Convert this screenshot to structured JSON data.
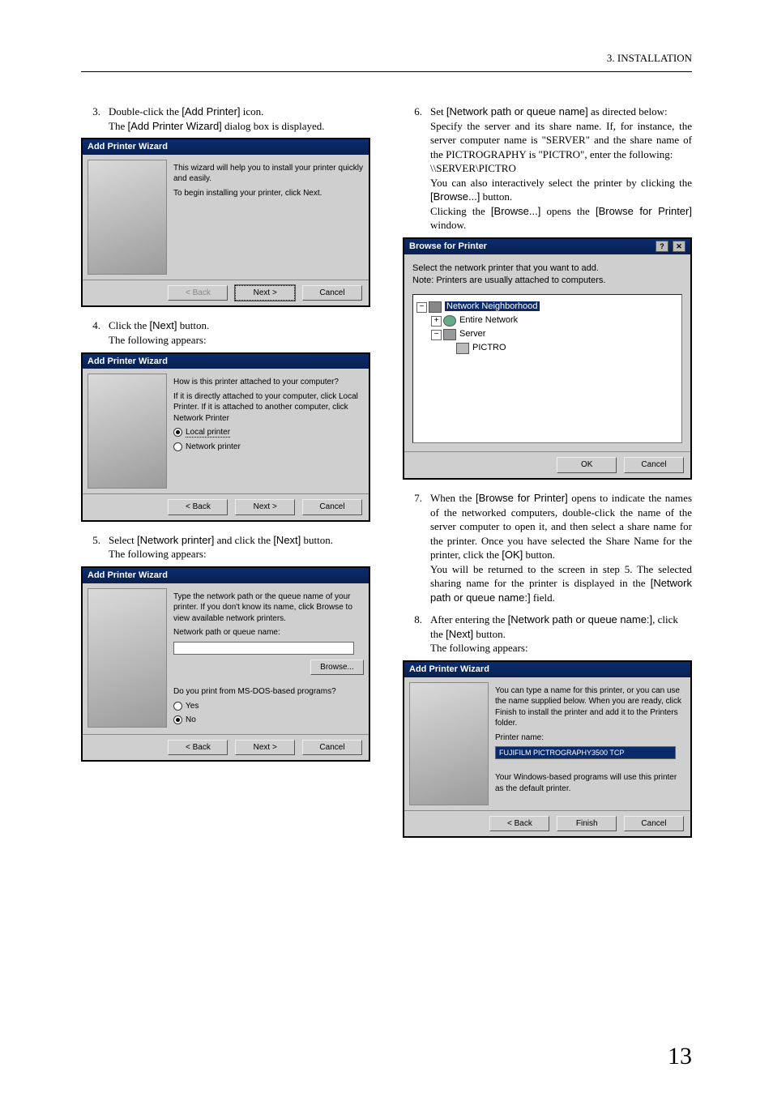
{
  "header": {
    "section_label": "3. INSTALLATION"
  },
  "page_number": "13",
  "left": {
    "step3": {
      "num": "3.",
      "line1_a": "Double-click the ",
      "line1_ui": "[Add Printer]",
      "line1_b": " icon.",
      "line2_a": "The ",
      "line2_ui": "[Add Printer Wizard]",
      "line2_b": " dialog box is displayed."
    },
    "dlg1": {
      "title": "Add Printer Wizard",
      "text1": "This wizard will help you to install your printer quickly and easily.",
      "text2": "To begin installing your printer, click Next.",
      "back": "< Back",
      "next": "Next >",
      "cancel": "Cancel"
    },
    "step4": {
      "num": "4.",
      "line1_a": "Click the ",
      "line1_ui": "[Next]",
      "line1_b": " button.",
      "line2": "The following appears:"
    },
    "dlg2": {
      "title": "Add Printer Wizard",
      "q": "How is this printer attached to your computer?",
      "text": "If it is directly attached to your computer, click Local Printer. If it is attached to another computer, click Network Printer",
      "opt1": "Local printer",
      "opt2": "Network printer",
      "back": "< Back",
      "next": "Next >",
      "cancel": "Cancel"
    },
    "step5": {
      "num": "5.",
      "line1_a": "Select ",
      "line1_ui": "[Network printer]",
      "line1_b": " and click the ",
      "line1_ui2": "[Next]",
      "line1_c": " button.",
      "line2": "The following appears:"
    },
    "dlg3": {
      "title": "Add Printer Wizard",
      "text": "Type the network path or the queue name of your printer. If you don't know its name, click Browse to view available network printers.",
      "label": "Network path or queue name:",
      "browse": "Browse...",
      "q2": "Do you print from MS-DOS-based programs?",
      "yes": "Yes",
      "no": "No",
      "back": "< Back",
      "next": "Next >",
      "cancel": "Cancel"
    }
  },
  "right": {
    "step6": {
      "num": "6.",
      "line1_a": "Set ",
      "line1_ui": "[Network path or queue name]",
      "line1_b": " as directed below:",
      "line2": "Specify the server and its share name.  If, for instance, the server computer name is \"SERVER\" and the share name of the PICTROGRAPHY is \"PICTRO\", enter the following:",
      "path": "\\\\SERVER\\PICTRO",
      "line3_a": "You can also interactively select the printer by clicking the ",
      "line3_ui": "[Browse...]",
      "line3_b": " button.",
      "line4_a": "Clicking the ",
      "line4_ui": "[Browse...]",
      "line4_b": " opens the ",
      "line4_ui2": "[Browse for Printer]",
      "line4_c": " window."
    },
    "browse_dlg": {
      "title": "Browse for Printer",
      "help": "?",
      "close": "✕",
      "instr1": "Select the network printer that you want to add.",
      "instr2": "Note: Printers are usually attached to computers.",
      "node_root": "Network Neighborhood",
      "node_entire": "Entire Network",
      "node_server": "Server",
      "node_pictro": "PICTRO",
      "ok": "OK",
      "cancel": "Cancel"
    },
    "step7": {
      "num": "7.",
      "line1_a": "When the ",
      "line1_ui": "[Browse for Printer]",
      "line1_b": " opens to indicate the names of the networked computers, double-click the name of the server computer to open it, and then select a share name for the printer. Once you have selected the Share Name for the printer, click the ",
      "line1_ui2": "[OK]",
      "line1_c": " button.",
      "line2_a": "You will be returned to the screen in step 5. The selected sharing name for the printer is displayed in the ",
      "line2_ui": "[Network path or queue name:]",
      "line2_b": " field."
    },
    "step8": {
      "num": "8.",
      "line1_a": "After entering the ",
      "line1_ui": "[Network path or queue name:]",
      "line1_b": ", click the ",
      "line1_ui2": "[Next]",
      "line1_c": " button.",
      "line2": "The following appears:"
    },
    "dlg4": {
      "title": "Add Printer Wizard",
      "text1": "You can type a name for this printer, or you can use the name supplied below. When you are ready, click Finish to install the printer and add it to the Printers folder.",
      "label": "Printer name:",
      "value": "FUJIFILM PICTROGRAPHY3500 TCP",
      "text2": "Your Windows-based programs will use this printer as the default printer.",
      "back": "< Back",
      "finish": "Finish",
      "cancel": "Cancel"
    }
  }
}
